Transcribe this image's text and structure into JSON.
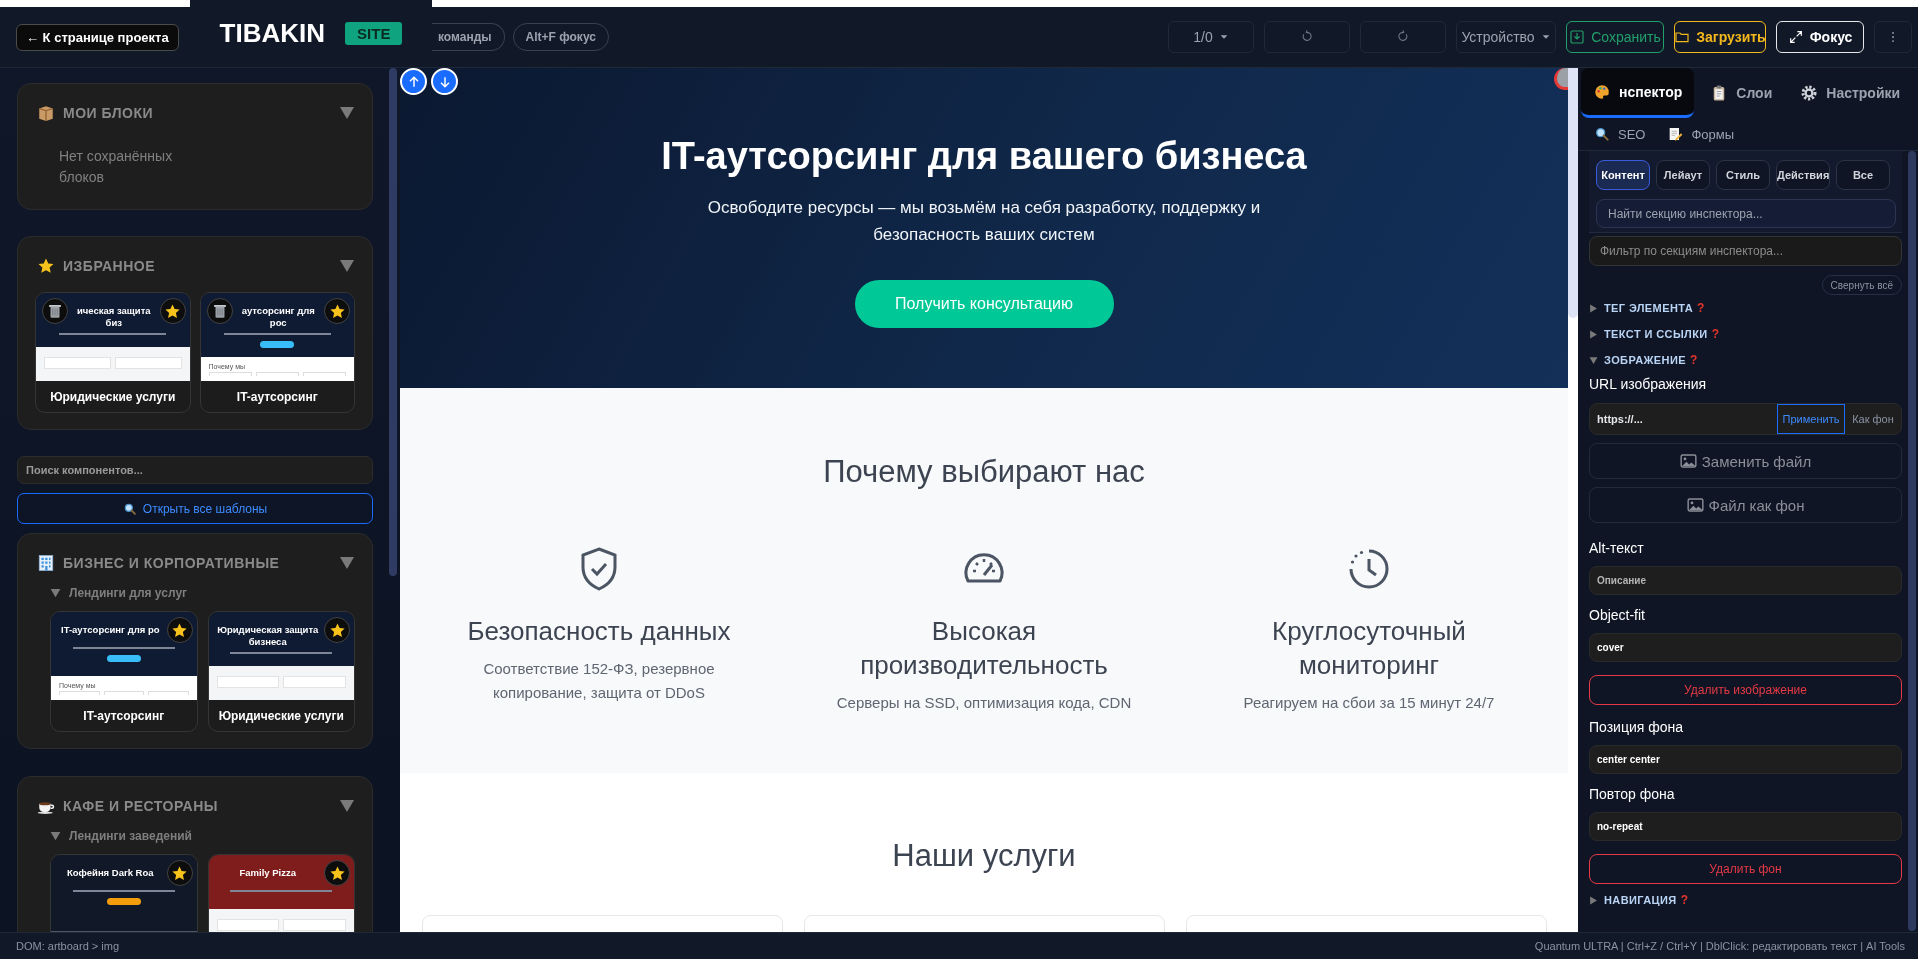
{
  "toolbar": {
    "back": "← К странице проекта",
    "logo": "TIBAKIN",
    "badge": "SITE",
    "hints": [
      "команды",
      "Alt+F фокус"
    ],
    "page": "1/0",
    "undo": {
      "disabled": true
    },
    "redo": {
      "disabled": true
    },
    "device": "Устройство",
    "actions": [
      {
        "kind": "save",
        "label": "Сохранить"
      },
      {
        "kind": "load",
        "label": "Загрузить"
      },
      {
        "kind": "focus",
        "label": "Фокус"
      }
    ]
  },
  "sidebar": {
    "blocks": [
      {
        "title": "МОИ БЛОКИ",
        "expanded": true,
        "empty_text": "Нет сохранённых блоков"
      },
      {
        "title": "ИЗБРАННОЕ",
        "expanded": true,
        "templates": [
          {
            "label": "Юридические услуги",
            "favorite": true,
            "removable": true,
            "preview": {
              "color": "#0f1a33",
              "title": "ическая защита биз",
              "lower": {
                "kind": "fields"
              }
            }
          },
          {
            "label": "IT-аутсорсинг",
            "favorite": true,
            "removable": true,
            "preview": {
              "color": "#0f1a33",
              "title": "аутсорсинг для рос",
              "cta": {
                "color": "#38bdf8"
              },
              "lower": {
                "kind": "heading",
                "text": "Почему мы"
              }
            }
          }
        ]
      }
    ],
    "search": {
      "placeholder": "Поиск компонентов..."
    },
    "open_all": "Открыть все шаблоны",
    "categories": [
      {
        "title": "БИЗНЕС И КОРПОРАТИВНЫЕ",
        "expanded": true,
        "groups": [
          {
            "title": "Лендинги для услуг",
            "expanded": true,
            "templates": [
              {
                "label": "IT-аутсорсинг",
                "favorite": true,
                "removable": false,
                "preview": {
                  "color": "#0f1a33",
                  "title": "IT-аутсорсинг для ро",
                  "cta": {
                    "color": "#38bdf8"
                  },
                  "lower": {
                    "kind": "heading",
                    "text": "Почему мы"
                  }
                }
              },
              {
                "label": "Юридические услуги",
                "favorite": true,
                "removable": false,
                "preview": {
                  "color": "#0f1a33",
                  "title": "Юридическая защита бизнеса",
                  "lower": {
                    "kind": "fields"
                  }
                }
              }
            ]
          }
        ]
      },
      {
        "title": "КАФЕ И РЕСТОРАНЫ",
        "expanded": true,
        "groups": [
          {
            "title": "Лендинги заведений",
            "expanded": true,
            "templates": [
              {
                "favorite": true,
                "removable": false,
                "preview": {
                  "color": "#111827",
                  "title": "Кофейня Dark Roa",
                  "cta": {
                    "color": "#f59e0b"
                  },
                  "lower": {
                    "kind": "dark"
                  }
                }
              },
              {
                "favorite": true,
                "removable": false,
                "preview": {
                  "color": "#7f1d1d",
                  "title": "Family Pizza",
                  "lower": {
                    "kind": "fields"
                  }
                }
              }
            ]
          }
        ]
      }
    ]
  },
  "canvas": {
    "hero": {
      "title": "IT-аутсорсинг для вашего бизнеса",
      "subtitle": "Освободите ресурсы — мы возьмём на себя разработку, поддержку и безопасность ваших систем",
      "cta": "Получить консультацию"
    },
    "features": {
      "heading": "Почему выбирают нас",
      "items": [
        {
          "title": "Безопасность данных",
          "text": "Соответствие 152-ФЗ, резервное копирование, защита от DDoS"
        },
        {
          "title": "Высокая производительность",
          "text": "Серверы на SSD, оптимизация кода, CDN"
        },
        {
          "title": "Круглосуточный мониторинг",
          "text": "Реагируем на сбои за 15 минут 24/7"
        }
      ]
    },
    "services": {
      "heading": "Наши услуги"
    }
  },
  "inspector": {
    "tabs": [
      {
        "label": "нспектор",
        "selected": true
      },
      {
        "label": "Слои",
        "selected": false
      },
      {
        "label": "Настройки",
        "selected": false
      }
    ],
    "subtabs": [
      {
        "label": "SEO",
        "selected": false
      },
      {
        "label": "Формы",
        "selected": false
      }
    ],
    "filters": [
      {
        "label": "Контент",
        "selected": true
      },
      {
        "label": "Лейаут",
        "selected": false
      },
      {
        "label": "Стиль",
        "selected": false
      },
      {
        "label": "Действия",
        "selected": false
      },
      {
        "label": "Все",
        "selected": false
      }
    ],
    "section_search": {
      "placeholder": "Найти секцию инспектора..."
    },
    "section_filter": {
      "placeholder": "Фильтр по секциям инспектора..."
    },
    "collapse_all": "Свернуть всё",
    "sections": [
      {
        "title": "ТЕГ ЭЛЕМЕНТА",
        "hint": "?",
        "expanded": false
      },
      {
        "title": "ТЕКСТ И ССЫЛКИ",
        "hint": "?",
        "expanded": false
      },
      {
        "title": "ЗОБРАЖЕНИЕ",
        "hint": "?",
        "expanded": true,
        "fields": [
          {
            "kind": "label",
            "text": "URL изображения"
          },
          {
            "kind": "url",
            "value": "https://...",
            "apply": "Применить",
            "alt": "Как фон"
          },
          {
            "kind": "file",
            "text": "Заменить файл"
          },
          {
            "kind": "file",
            "text": "Файл как фон"
          },
          {
            "kind": "label",
            "text": "Alt-текст"
          },
          {
            "kind": "input",
            "placeholder": "Описание"
          },
          {
            "kind": "label",
            "text": "Object-fit"
          },
          {
            "kind": "input",
            "value": "cover"
          },
          {
            "kind": "danger",
            "text": "Удалить изображение"
          },
          {
            "kind": "label",
            "text": "Позиция фона"
          },
          {
            "kind": "input",
            "value": "center center"
          },
          {
            "kind": "label",
            "text": "Повтор фона"
          },
          {
            "kind": "input",
            "value": "no-repeat"
          },
          {
            "kind": "danger",
            "text": "Удалить фон"
          }
        ]
      },
      {
        "title": "НАВИГАЦИЯ",
        "hint": "?",
        "expanded": false
      }
    ]
  },
  "status_bar": {
    "path": "DOM: artboard > img",
    "hints": "Quantum ULTRA | Ctrl+Z / Ctrl+Y | DblClick: редактировать текст | AI Tools"
  }
}
